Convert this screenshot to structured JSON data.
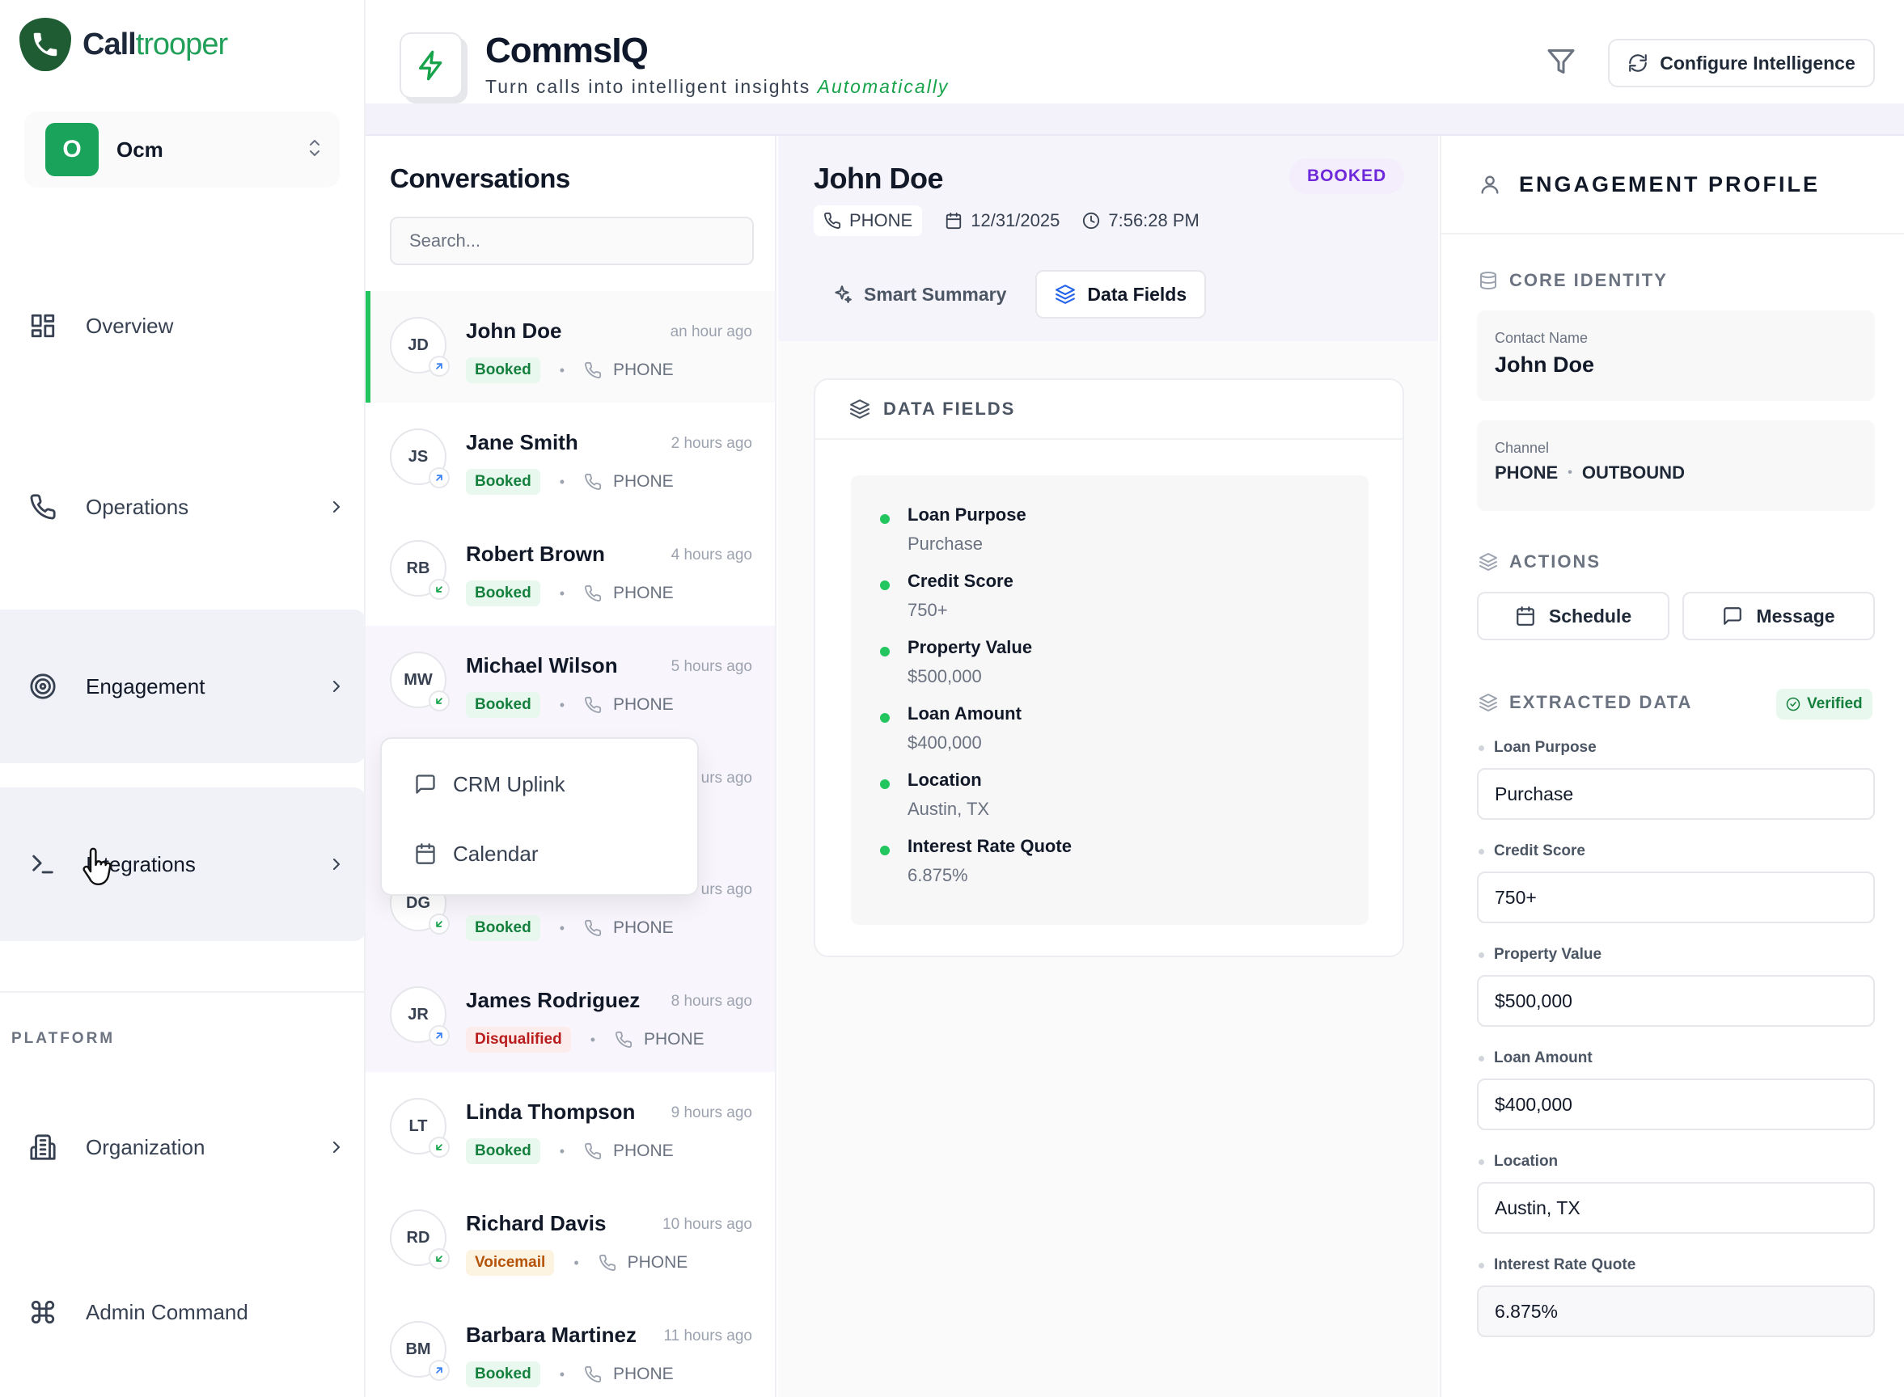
{
  "brand": {
    "logo_call": "Call",
    "logo_trooper": "trooper"
  },
  "org": {
    "initial": "O",
    "name": "Ocm"
  },
  "nav": {
    "overview": "Overview",
    "operations": "Operations",
    "engagement": "Engagement",
    "integrations": "Integrations",
    "platform_label": "PLATFORM",
    "organization": "Organization",
    "admin_command": "Admin Command"
  },
  "header": {
    "title": "CommsIQ",
    "subtitle": "Turn calls into intelligent insights",
    "subtitle_accent": "Automatically",
    "configure_label": "Configure Intelligence"
  },
  "conversations": {
    "title": "Conversations",
    "search_placeholder": "Search...",
    "items": [
      {
        "initials": "JD",
        "name": "John Doe",
        "time": "an hour ago",
        "status": "Booked",
        "channel": "PHONE",
        "direction": "outbound"
      },
      {
        "initials": "JS",
        "name": "Jane Smith",
        "time": "2 hours ago",
        "status": "Booked",
        "channel": "PHONE",
        "direction": "outbound"
      },
      {
        "initials": "RB",
        "name": "Robert Brown",
        "time": "4 hours ago",
        "status": "Booked",
        "channel": "PHONE",
        "direction": "inbound"
      },
      {
        "initials": "MW",
        "name": "Michael Wilson",
        "time": "5 hours ago",
        "status": "Booked",
        "channel": "PHONE",
        "direction": "inbound"
      },
      {
        "initials": "",
        "name": "",
        "time": "urs ago",
        "status": "",
        "channel": "",
        "direction": ""
      },
      {
        "initials": "DG",
        "name": "",
        "time": "urs ago",
        "status": "Booked",
        "channel": "PHONE",
        "direction": "inbound"
      },
      {
        "initials": "JR",
        "name": "James Rodriguez",
        "time": "8 hours ago",
        "status": "Disqualified",
        "channel": "PHONE",
        "direction": "outbound"
      },
      {
        "initials": "LT",
        "name": "Linda Thompson",
        "time": "9 hours ago",
        "status": "Booked",
        "channel": "PHONE",
        "direction": "inbound"
      },
      {
        "initials": "RD",
        "name": "Richard Davis",
        "time": "10 hours ago",
        "status": "Voicemail",
        "channel": "PHONE",
        "direction": "inbound"
      },
      {
        "initials": "BM",
        "name": "Barbara Martinez",
        "time": "11 hours ago",
        "status": "Booked",
        "channel": "PHONE",
        "direction": "outbound"
      }
    ]
  },
  "dropdown": {
    "items": [
      "CRM Uplink",
      "Calendar"
    ]
  },
  "detail": {
    "name": "John Doe",
    "status": "BOOKED",
    "channel": "PHONE",
    "date": "12/31/2025",
    "time": "7:56:28 PM",
    "tabs": [
      "Smart Summary",
      "Data Fields"
    ],
    "card_title": "DATA FIELDS",
    "fields": [
      {
        "label": "Loan Purpose",
        "value": "Purchase"
      },
      {
        "label": "Credit Score",
        "value": "750+"
      },
      {
        "label": "Property Value",
        "value": "$500,000"
      },
      {
        "label": "Loan Amount",
        "value": "$400,000"
      },
      {
        "label": "Location",
        "value": "Austin, TX"
      },
      {
        "label": "Interest Rate Quote",
        "value": "6.875%"
      }
    ]
  },
  "profile": {
    "title": "ENGAGEMENT PROFILE",
    "core_identity": "CORE IDENTITY",
    "contact_name_label": "Contact Name",
    "contact_name": "John Doe",
    "channel_label": "Channel",
    "channel": "PHONE",
    "direction": "OUTBOUND",
    "actions_title": "ACTIONS",
    "schedule_label": "Schedule",
    "message_label": "Message",
    "extracted_title": "EXTRACTED DATA",
    "verified_label": "Verified",
    "extracted": [
      {
        "label": "Loan Purpose",
        "value": "Purchase"
      },
      {
        "label": "Credit Score",
        "value": "750+"
      },
      {
        "label": "Property Value",
        "value": "$500,000"
      },
      {
        "label": "Loan Amount",
        "value": "$400,000"
      },
      {
        "label": "Location",
        "value": "Austin, TX"
      },
      {
        "label": "Interest Rate Quote",
        "value": "6.875%"
      }
    ]
  }
}
